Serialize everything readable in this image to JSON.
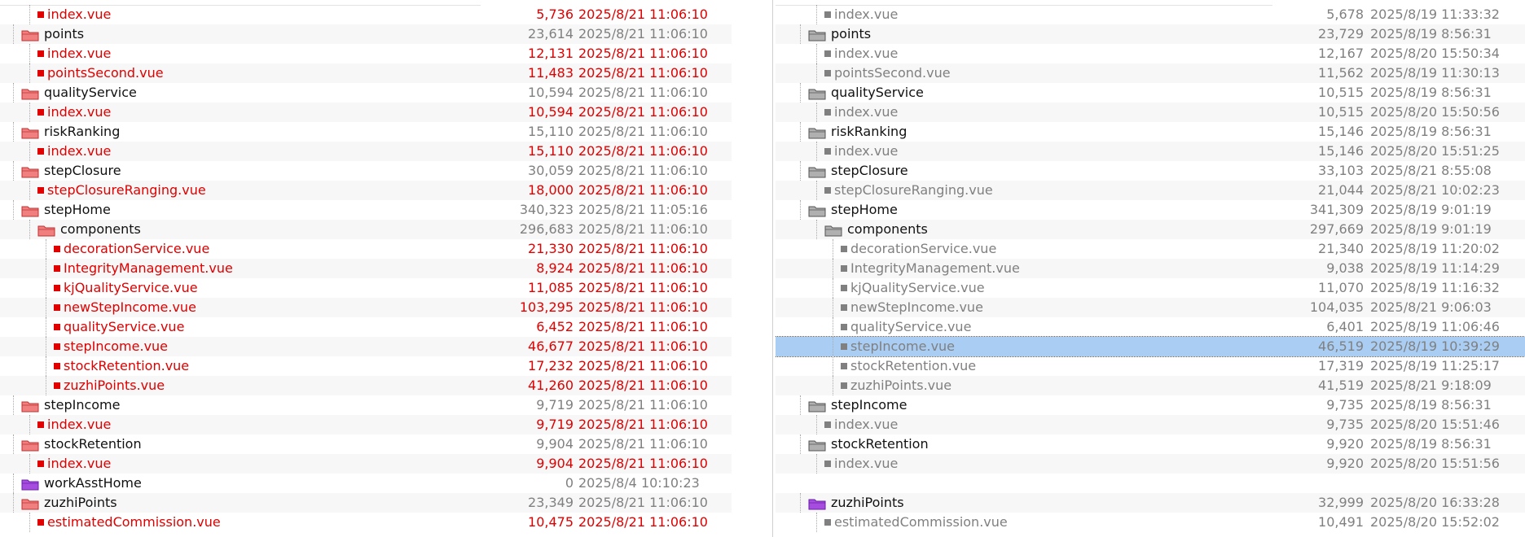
{
  "not_equal_symbol": "≠",
  "left_rows": [
    {
      "name": "index.vue",
      "kind": "file",
      "state": "diff",
      "size": "5,736",
      "date": "2025/8/21 11:06:10",
      "ne": true
    },
    {
      "name": "points",
      "kind": "folder",
      "state": "diff",
      "size": "23,614",
      "date": "2025/8/21 11:06:10",
      "ne": false
    },
    {
      "name": "index.vue",
      "kind": "file",
      "state": "diff",
      "size": "12,131",
      "date": "2025/8/21 11:06:10",
      "ne": true
    },
    {
      "name": "pointsSecond.vue",
      "kind": "file",
      "state": "diff",
      "size": "11,483",
      "date": "2025/8/21 11:06:10",
      "ne": true
    },
    {
      "name": "qualityService",
      "kind": "folder",
      "state": "diff",
      "size": "10,594",
      "date": "2025/8/21 11:06:10",
      "ne": false
    },
    {
      "name": "index.vue",
      "kind": "file",
      "state": "diff",
      "size": "10,594",
      "date": "2025/8/21 11:06:10",
      "ne": true
    },
    {
      "name": "riskRanking",
      "kind": "folder",
      "state": "diff",
      "size": "15,110",
      "date": "2025/8/21 11:06:10",
      "ne": false
    },
    {
      "name": "index.vue",
      "kind": "file",
      "state": "diff",
      "size": "15,110",
      "date": "2025/8/21 11:06:10",
      "ne": true
    },
    {
      "name": "stepClosure",
      "kind": "folder",
      "state": "diff",
      "size": "30,059",
      "date": "2025/8/21 11:06:10",
      "ne": false
    },
    {
      "name": "stepClosureRanging.vue",
      "kind": "file",
      "state": "diff",
      "size": "18,000",
      "date": "2025/8/21 11:06:10",
      "ne": true
    },
    {
      "name": "stepHome",
      "kind": "folder",
      "state": "diff",
      "size": "340,323",
      "date": "2025/8/21 11:05:16",
      "ne": false
    },
    {
      "name": "components",
      "kind": "folder",
      "state": "diff",
      "size": "296,683",
      "date": "2025/8/21 11:06:10",
      "ne": false
    },
    {
      "name": "decorationService.vue",
      "kind": "file",
      "state": "diff",
      "size": "21,330",
      "date": "2025/8/21 11:06:10",
      "ne": true
    },
    {
      "name": "IntegrityManagement.vue",
      "kind": "file",
      "state": "diff",
      "size": "8,924",
      "date": "2025/8/21 11:06:10",
      "ne": true
    },
    {
      "name": "kjQualityService.vue",
      "kind": "file",
      "state": "diff",
      "size": "11,085",
      "date": "2025/8/21 11:06:10",
      "ne": true
    },
    {
      "name": "newStepIncome.vue",
      "kind": "file",
      "state": "diff",
      "size": "103,295",
      "date": "2025/8/21 11:06:10",
      "ne": true
    },
    {
      "name": "qualityService.vue",
      "kind": "file",
      "state": "diff",
      "size": "6,452",
      "date": "2025/8/21 11:06:10",
      "ne": true
    },
    {
      "name": "stepIncome.vue",
      "kind": "file",
      "state": "diff",
      "size": "46,677",
      "date": "2025/8/21 11:06:10",
      "ne": true
    },
    {
      "name": "stockRetention.vue",
      "kind": "file",
      "state": "diff",
      "size": "17,232",
      "date": "2025/8/21 11:06:10",
      "ne": true
    },
    {
      "name": "zuzhiPoints.vue",
      "kind": "file",
      "state": "diff",
      "size": "41,260",
      "date": "2025/8/21 11:06:10",
      "ne": true
    },
    {
      "name": "stepIncome",
      "kind": "folder",
      "state": "diff",
      "size": "9,719",
      "date": "2025/8/21 11:06:10",
      "ne": false
    },
    {
      "name": "index.vue",
      "kind": "file",
      "state": "diff",
      "size": "9,719",
      "date": "2025/8/21 11:06:10",
      "ne": true
    },
    {
      "name": "stockRetention",
      "kind": "folder",
      "state": "diff",
      "size": "9,904",
      "date": "2025/8/21 11:06:10",
      "ne": false
    },
    {
      "name": "index.vue",
      "kind": "file",
      "state": "diff",
      "size": "9,904",
      "date": "2025/8/21 11:06:10",
      "ne": true
    },
    {
      "name": "workAsstHome",
      "kind": "folder",
      "state": "orphan",
      "size": "0",
      "date": "2025/8/4 10:10:23",
      "ne": false
    },
    {
      "name": "zuzhiPoints",
      "kind": "folder",
      "state": "diff",
      "size": "23,349",
      "date": "2025/8/21 11:06:10",
      "ne": false
    },
    {
      "name": "estimatedCommission.vue",
      "kind": "file",
      "state": "diff",
      "size": "10,475",
      "date": "2025/8/21 11:06:10",
      "ne": true
    }
  ],
  "right_rows": [
    {
      "name": "index.vue",
      "kind": "file",
      "state": "same",
      "size": "5,678",
      "date": "2025/8/19 11:33:32",
      "selected": false
    },
    {
      "name": "points",
      "kind": "folder",
      "state": "same",
      "size": "23,729",
      "date": "2025/8/19 8:56:31",
      "selected": false
    },
    {
      "name": "index.vue",
      "kind": "file",
      "state": "same",
      "size": "12,167",
      "date": "2025/8/20 15:50:34",
      "selected": false
    },
    {
      "name": "pointsSecond.vue",
      "kind": "file",
      "state": "same",
      "size": "11,562",
      "date": "2025/8/19 11:30:13",
      "selected": false
    },
    {
      "name": "qualityService",
      "kind": "folder",
      "state": "same",
      "size": "10,515",
      "date": "2025/8/19 8:56:31",
      "selected": false
    },
    {
      "name": "index.vue",
      "kind": "file",
      "state": "same",
      "size": "10,515",
      "date": "2025/8/20 15:50:56",
      "selected": false
    },
    {
      "name": "riskRanking",
      "kind": "folder",
      "state": "same",
      "size": "15,146",
      "date": "2025/8/19 8:56:31",
      "selected": false
    },
    {
      "name": "index.vue",
      "kind": "file",
      "state": "same",
      "size": "15,146",
      "date": "2025/8/20 15:51:25",
      "selected": false
    },
    {
      "name": "stepClosure",
      "kind": "folder",
      "state": "same",
      "size": "33,103",
      "date": "2025/8/21 8:55:08",
      "selected": false
    },
    {
      "name": "stepClosureRanging.vue",
      "kind": "file",
      "state": "same",
      "size": "21,044",
      "date": "2025/8/21 10:02:23",
      "selected": false
    },
    {
      "name": "stepHome",
      "kind": "folder",
      "state": "same",
      "size": "341,309",
      "date": "2025/8/19 9:01:19",
      "selected": false
    },
    {
      "name": "components",
      "kind": "folder",
      "state": "same",
      "size": "297,669",
      "date": "2025/8/19 9:01:19",
      "selected": false
    },
    {
      "name": "decorationService.vue",
      "kind": "file",
      "state": "same",
      "size": "21,340",
      "date": "2025/8/19 11:20:02",
      "selected": false
    },
    {
      "name": "IntegrityManagement.vue",
      "kind": "file",
      "state": "same",
      "size": "9,038",
      "date": "2025/8/19 11:14:29",
      "selected": false
    },
    {
      "name": "kjQualityService.vue",
      "kind": "file",
      "state": "same",
      "size": "11,070",
      "date": "2025/8/19 11:16:32",
      "selected": false
    },
    {
      "name": "newStepIncome.vue",
      "kind": "file",
      "state": "same",
      "size": "104,035",
      "date": "2025/8/21 9:06:03",
      "selected": false
    },
    {
      "name": "qualityService.vue",
      "kind": "file",
      "state": "same",
      "size": "6,401",
      "date": "2025/8/19 11:06:46",
      "selected": false
    },
    {
      "name": "stepIncome.vue",
      "kind": "file",
      "state": "same",
      "size": "46,519",
      "date": "2025/8/19 10:39:29",
      "selected": true
    },
    {
      "name": "stockRetention.vue",
      "kind": "file",
      "state": "same",
      "size": "17,319",
      "date": "2025/8/19 11:25:17",
      "selected": false
    },
    {
      "name": "zuzhiPoints.vue",
      "kind": "file",
      "state": "same",
      "size": "41,519",
      "date": "2025/8/21 9:18:09",
      "selected": false
    },
    {
      "name": "stepIncome",
      "kind": "folder",
      "state": "same",
      "size": "9,735",
      "date": "2025/8/19 8:56:31",
      "selected": false
    },
    {
      "name": "index.vue",
      "kind": "file",
      "state": "same",
      "size": "9,735",
      "date": "2025/8/20 15:51:46",
      "selected": false
    },
    {
      "name": "stockRetention",
      "kind": "folder",
      "state": "same",
      "size": "9,920",
      "date": "2025/8/19 8:56:31",
      "selected": false
    },
    {
      "name": "index.vue",
      "kind": "file",
      "state": "same",
      "size": "9,920",
      "date": "2025/8/20 15:51:56",
      "selected": false
    },
    {
      "name": "",
      "kind": "blank",
      "state": "same",
      "size": "",
      "date": "",
      "selected": false
    },
    {
      "name": "zuzhiPoints",
      "kind": "folder",
      "state": "orphan",
      "size": "32,999",
      "date": "2025/8/20 16:33:28",
      "selected": false
    },
    {
      "name": "estimatedCommission.vue",
      "kind": "file",
      "state": "same",
      "size": "10,491",
      "date": "2025/8/20 15:52:02",
      "selected": false
    }
  ],
  "colors": {
    "diff": "#e00000",
    "same": "#808080",
    "folder_diff": "#f08080",
    "folder_same": "#b0b0b0",
    "folder_orphan": "#a64de0",
    "selection": "#a9cdf3"
  }
}
